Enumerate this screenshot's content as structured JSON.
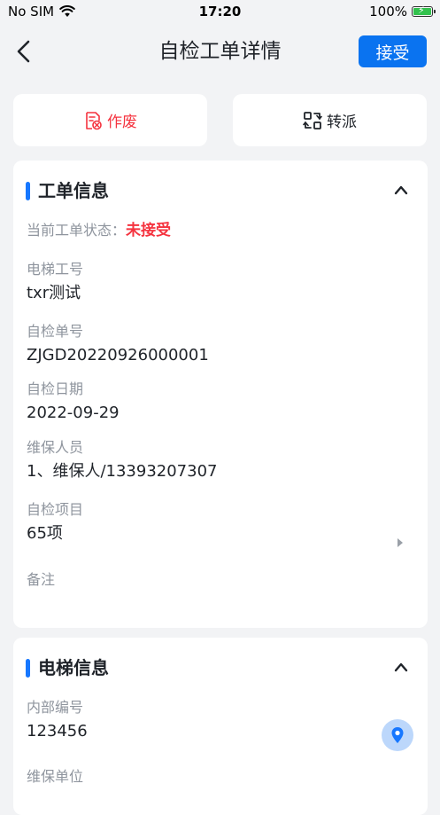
{
  "status_bar": {
    "carrier": "No SIM",
    "time": "17:20",
    "battery_percent": "100%",
    "battery_level": 1.0
  },
  "nav": {
    "title": "自检工单详情",
    "accept_label": "接受"
  },
  "actions": {
    "void_label": "作废",
    "transfer_label": "转派"
  },
  "work_order": {
    "title": "工单信息",
    "status_label": "当前工单状态：",
    "status_value": "未接受",
    "fields": [
      {
        "label": "电梯工号",
        "value": "txr测试"
      },
      {
        "label": "自检单号",
        "value": "ZJGD20220926000001"
      },
      {
        "label": "自检日期",
        "value": "2022-09-29"
      },
      {
        "label": "维保人员",
        "value": "1、维保人/13393207307"
      },
      {
        "label": "自检项目",
        "value": "65项"
      },
      {
        "label": "备注",
        "value": ""
      }
    ]
  },
  "elevator": {
    "title": "电梯信息",
    "fields": [
      {
        "label": "内部编号",
        "value": "123456"
      },
      {
        "label": "维保单位",
        "value": ""
      }
    ]
  },
  "colors": {
    "primary": "#1677ff",
    "danger": "#f5333f",
    "accept_button": "#0a73f0",
    "battery": "#33c24d",
    "background": "#f2f3f5"
  },
  "icons": {
    "back": "chevron-left-icon",
    "void": "void-document-icon",
    "transfer": "transfer-icon",
    "collapse": "chevron-up-icon",
    "detail": "triangle-right-icon",
    "location": "location-pin-icon",
    "wifi": "wifi-icon",
    "battery": "battery-charging-icon"
  }
}
